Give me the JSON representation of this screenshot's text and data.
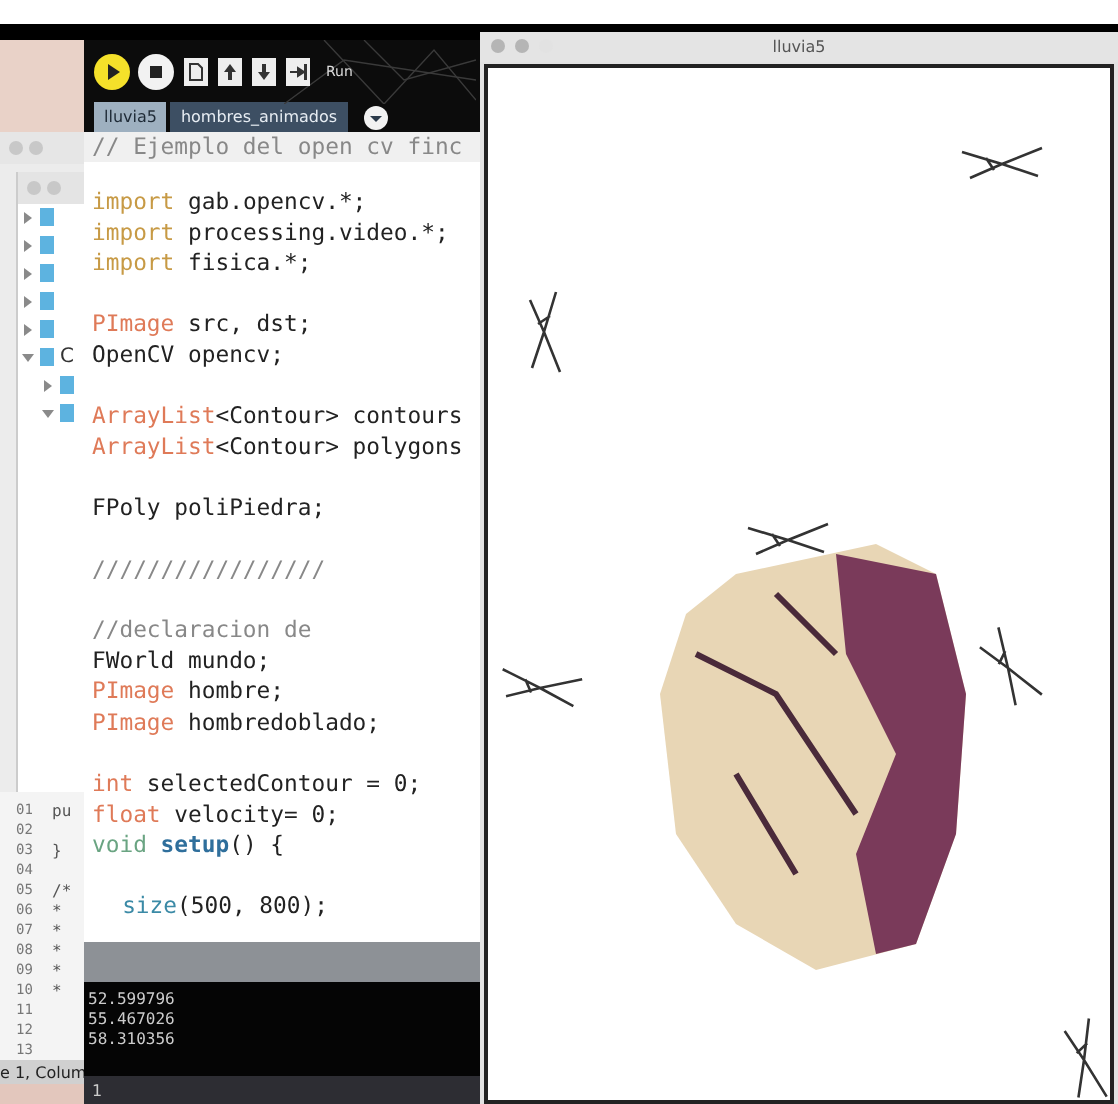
{
  "file_tree": {
    "items": [
      {
        "expanded": false
      },
      {
        "expanded": false
      },
      {
        "expanded": false
      },
      {
        "expanded": false
      },
      {
        "expanded": false
      },
      {
        "label": "C",
        "expanded": true,
        "children": [
          {
            "expanded": false
          },
          {
            "expanded": true
          }
        ]
      }
    ]
  },
  "background_editor": {
    "lines": [
      {
        "number": "01",
        "code": "pu"
      },
      {
        "number": "02"
      },
      {
        "number": "03",
        "code": "}"
      },
      {
        "number": "04"
      },
      {
        "number": "05",
        "code": "/*"
      },
      {
        "number": "06",
        "code": "*"
      },
      {
        "number": "07",
        "code": "*"
      },
      {
        "number": "08",
        "code": "*"
      },
      {
        "number": "09",
        "code": "*"
      },
      {
        "number": "10",
        "code": "*"
      },
      {
        "number": "11"
      },
      {
        "number": "12"
      },
      {
        "number": "13"
      }
    ],
    "status": "e 1, Colum"
  },
  "editor": {
    "toolbar": [
      {
        "kind": "run"
      },
      {
        "kind": "stop"
      },
      {
        "kind": "new"
      },
      {
        "kind": "open"
      },
      {
        "kind": "save"
      },
      {
        "kind": "export"
      }
    ],
    "run_label": "Run",
    "tabs": [
      {
        "label": "lluvia5",
        "selected": true
      },
      {
        "label": "hombres_animados",
        "selected": false
      }
    ],
    "code": [
      {
        "header": true,
        "tokens": [
          {
            "text": "// Ejemplo del open cv finc",
            "kind": "comment"
          }
        ]
      },
      {
        "gap_before": true,
        "tokens": [
          {
            "text": "import",
            "kind": "import"
          },
          {
            "text": " gab.opencv.*;",
            "kind": "plain"
          }
        ]
      },
      {
        "tokens": [
          {
            "text": "import",
            "kind": "import"
          },
          {
            "text": " processing.video.*;",
            "kind": "plain"
          }
        ]
      },
      {
        "tokens": [
          {
            "text": "import",
            "kind": "import"
          },
          {
            "text": " fisica.*;",
            "kind": "plain"
          }
        ]
      },
      {
        "gap_before": true,
        "tokens": [
          {
            "text": "PImage",
            "kind": "type"
          },
          {
            "text": " src, dst;",
            "kind": "plain"
          }
        ]
      },
      {
        "tokens": [
          {
            "text": "OpenCV opencv;",
            "kind": "plain"
          }
        ]
      },
      {
        "gap_before": true,
        "tokens": [
          {
            "text": "ArrayList",
            "kind": "type"
          },
          {
            "text": "<Contour> contours",
            "kind": "plain"
          }
        ]
      },
      {
        "tokens": [
          {
            "text": "ArrayList",
            "kind": "type"
          },
          {
            "text": "<Contour> polygons",
            "kind": "plain"
          }
        ]
      },
      {
        "gap_before": true,
        "tokens": [
          {
            "text": "FPoly poliPiedra;",
            "kind": "plain"
          }
        ]
      },
      {
        "gap_before": true,
        "tokens": [
          {
            "text": "/////////////////",
            "kind": "comment"
          }
        ]
      },
      {
        "gap_before": true,
        "tokens": [
          {
            "text": "//declaracion de",
            "kind": "comment"
          }
        ]
      },
      {
        "tokens": [
          {
            "text": "FWorld mundo;",
            "kind": "plain"
          }
        ]
      },
      {
        "tokens": [
          {
            "text": "PImage",
            "kind": "type"
          },
          {
            "text": " hombre;",
            "kind": "plain"
          }
        ]
      },
      {
        "tokens": [
          {
            "text": "PImage",
            "kind": "type"
          },
          {
            "text": " hombredoblado;",
            "kind": "plain"
          }
        ]
      },
      {
        "gap_before": true,
        "tokens": [
          {
            "text": "int",
            "kind": "type"
          },
          {
            "text": " selectedContour = 0;",
            "kind": "plain"
          }
        ]
      },
      {
        "tokens": [
          {
            "text": "float",
            "kind": "type"
          },
          {
            "text": " velocity= 0;",
            "kind": "plain"
          }
        ]
      },
      {
        "tokens": [
          {
            "text": "void ",
            "kind": "void"
          },
          {
            "text": "setup",
            "kind": "function"
          },
          {
            "text": "() {",
            "kind": "plain"
          }
        ]
      },
      {
        "gap_before": true,
        "indent": true,
        "tokens": [
          {
            "text": "size",
            "kind": "builtin"
          },
          {
            "text": "(500, 800);",
            "kind": "plain"
          }
        ]
      }
    ],
    "console": [
      "52.599796",
      "55.467026",
      "58.310356"
    ],
    "footer": "1"
  },
  "sketch": {
    "title": "lluvia5"
  }
}
